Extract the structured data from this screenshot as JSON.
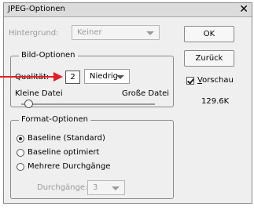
{
  "window": {
    "title": "JPEG-Optionen",
    "close": "✕"
  },
  "background_select": {
    "label": "Hintergrund:",
    "value": "Keiner"
  },
  "image_options": {
    "legend": "Bild-Optionen",
    "quality_label": "Qualität:",
    "quality_value": "2",
    "quality_preset": "Niedrig",
    "small_file": "Kleine Datei",
    "large_file": "Große Datei"
  },
  "format_options": {
    "legend": "Format-Optionen",
    "options": [
      "Baseline (Standard)",
      "Baseline optimiert",
      "Mehrere Durchgänge"
    ],
    "passes_label": "Durchgänge:",
    "passes_value": "3"
  },
  "buttons": {
    "ok": "OK",
    "back": "Zurück"
  },
  "preview": {
    "label_first": "V",
    "label_rest": "orschau",
    "size": "129.6K"
  },
  "colors": {
    "annotation_arrow": "#e31e24"
  }
}
